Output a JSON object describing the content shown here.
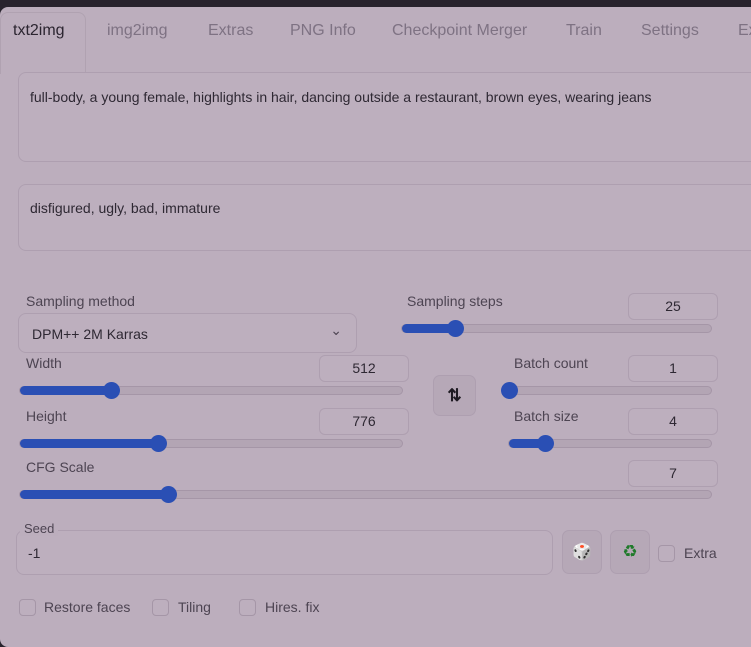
{
  "tabs": [
    {
      "label": "txt2img",
      "active": true
    },
    {
      "label": "img2img"
    },
    {
      "label": "Extras"
    },
    {
      "label": "PNG Info"
    },
    {
      "label": "Checkpoint Merger"
    },
    {
      "label": "Train"
    },
    {
      "label": "Settings"
    },
    {
      "label": "Ex"
    }
  ],
  "prompt": "full-body, a young female, highlights in hair, dancing outside a restaurant, brown eyes, wearing jeans",
  "negative_prompt": "disfigured, ugly, bad, immature",
  "sampling_method": {
    "label": "Sampling method",
    "value": "DPM++ 2M Karras"
  },
  "sliders": {
    "steps": {
      "label": "Sampling steps",
      "value": "25",
      "fraction": 0.17
    },
    "width": {
      "label": "Width",
      "value": "512",
      "fraction": 0.237
    },
    "height": {
      "label": "Height",
      "value": "776",
      "fraction": 0.362
    },
    "batch_count": {
      "label": "Batch count",
      "value": "1",
      "fraction": 0
    },
    "batch_size": {
      "label": "Batch size",
      "value": "4",
      "fraction": 0.18
    },
    "cfg": {
      "label": "CFG Scale",
      "value": "7",
      "fraction": 0.214
    }
  },
  "seed": {
    "label": "Seed",
    "value": "-1"
  },
  "extra_label": "Extra",
  "checkboxes": {
    "restore_faces": "Restore faces",
    "tiling": "Tiling",
    "hires_fix": "Hires. fix"
  },
  "colors": {
    "accent": "#2a4fb4",
    "recycle": "#1f7a2a"
  }
}
